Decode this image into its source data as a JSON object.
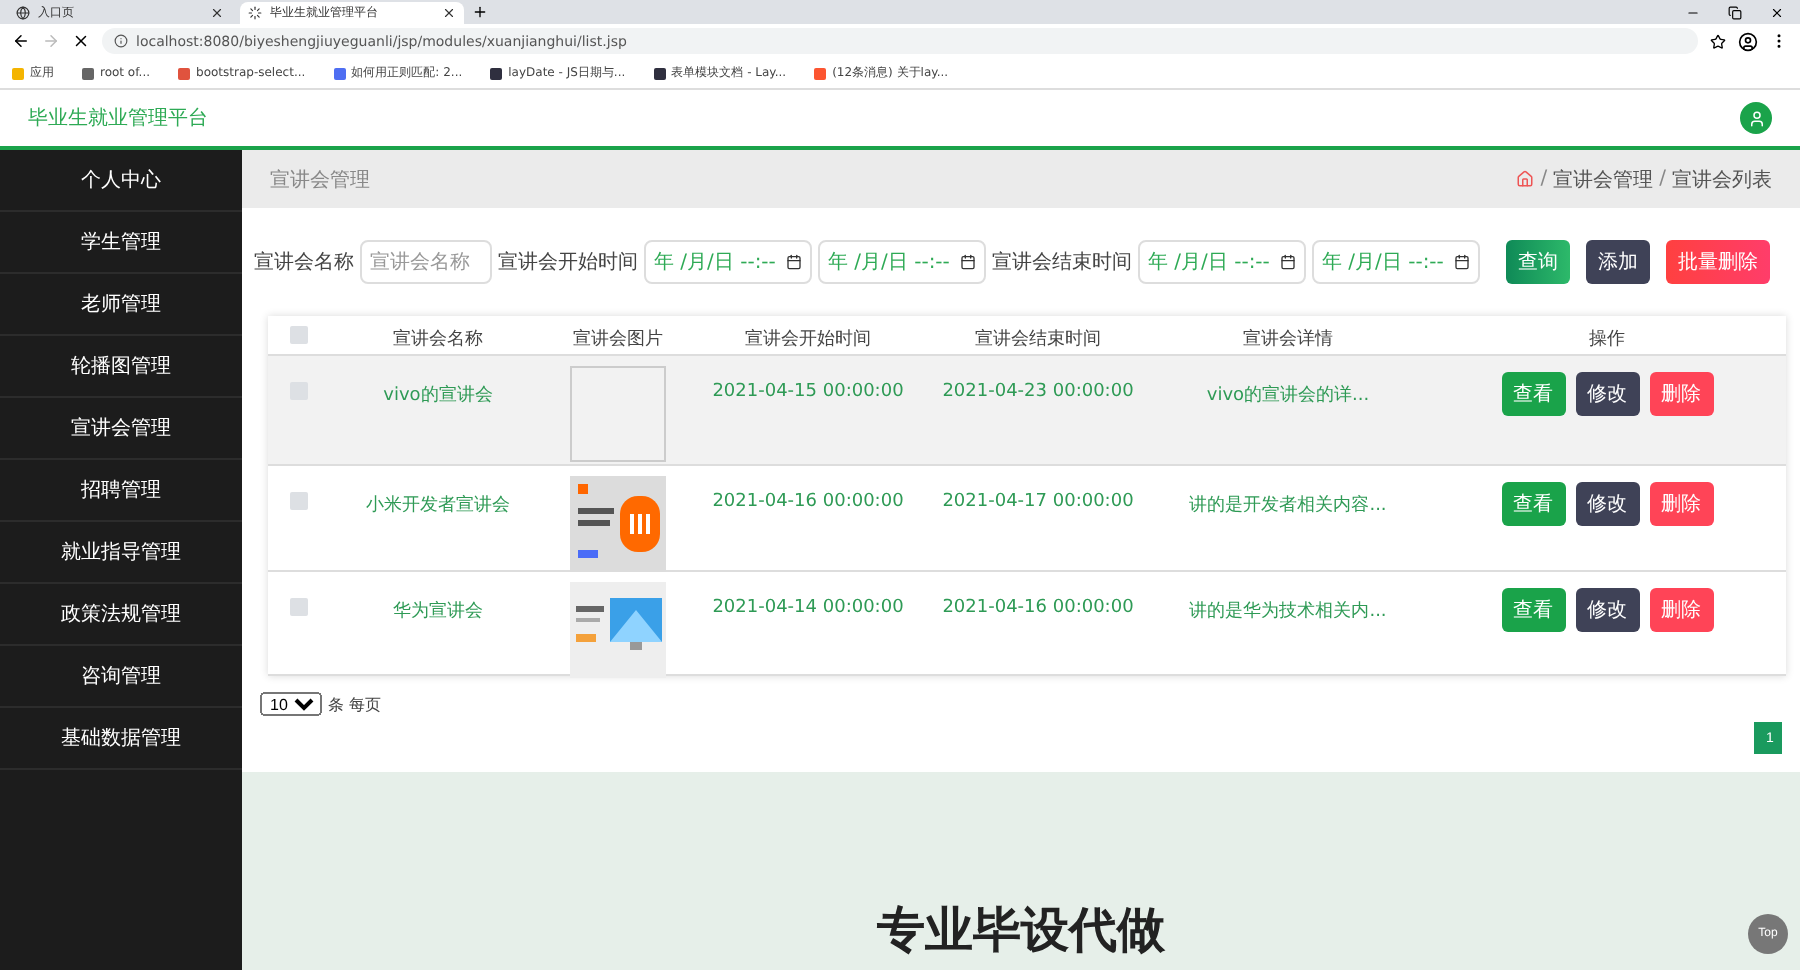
{
  "browser": {
    "tabs": [
      {
        "label": "入口页",
        "selected": false
      },
      {
        "label": "毕业生就业管理平台",
        "selected": true
      }
    ],
    "url": "localhost:8080/biyeshengjiuyeguanli/jsp/modules/xuanjianghui/list.jsp",
    "bookmarks": [
      {
        "label": "应用",
        "color": "#f4b400"
      },
      {
        "label": "root of...",
        "color": "#666666"
      },
      {
        "label": "bootstrap-select...",
        "color": "#e0533e"
      },
      {
        "label": "如何用正则匹配: 2...",
        "color": "#4e6ef2"
      },
      {
        "label": "layDate - JS日期与...",
        "color": "#2f2f3f"
      },
      {
        "label": "表单模块文档 - Lay...",
        "color": "#2f2f3f"
      },
      {
        "label": "(12条消息) 关于lay...",
        "color": "#fc5531"
      }
    ]
  },
  "header": {
    "title": "毕业生就业管理平台"
  },
  "sidebar": {
    "items": [
      {
        "label": "个人中心",
        "selected": false
      },
      {
        "label": "学生管理",
        "selected": false
      },
      {
        "label": "老师管理",
        "selected": false
      },
      {
        "label": "轮播图管理",
        "selected": false
      },
      {
        "label": "宣讲会管理",
        "selected": false
      },
      {
        "label": "招聘管理",
        "selected": false
      },
      {
        "label": "就业指导管理",
        "selected": false
      },
      {
        "label": "政策法规管理",
        "selected": false
      },
      {
        "label": "咨询管理",
        "selected": false
      },
      {
        "label": "基础数据管理",
        "selected": false
      }
    ]
  },
  "page_title": "宣讲会管理",
  "breadcrumb": [
    {
      "separator": "/",
      "label": "宣讲会管理"
    },
    {
      "separator": "/",
      "label": "宣讲会列表"
    }
  ],
  "search": {
    "name_label": "宣讲会名称",
    "name_placeholder": "宣讲会名称",
    "start_label": "宣讲会开始时间",
    "end_label": "宣讲会结束时间",
    "start_dates": [
      "年 /月/日 --:--",
      "年 /月/日 --:--"
    ],
    "end_dates": [
      "年 /月/日 --:--",
      "年 /月/日 --:--"
    ],
    "buttons": [
      {
        "label": "查询",
        "kind": "search"
      },
      {
        "label": "添加",
        "kind": "add"
      },
      {
        "label": "批量删除",
        "kind": "delete"
      }
    ]
  },
  "table": {
    "header_checked": false,
    "columns": [
      "宣讲会名称",
      "宣讲会图片",
      "宣讲会开始时间",
      "宣讲会结束时间",
      "宣讲会详情",
      "操作"
    ],
    "rows": [
      {
        "checked": false,
        "highlighted": true,
        "name": "vivo的宣讲会",
        "image": {
          "kind": "broken"
        },
        "start": "2021-04-15 00:00:00",
        "end": "2021-04-23 00:00:00",
        "detail": "vivo的宣讲会的详...",
        "actions": [
          "查看",
          "修改",
          "删除"
        ]
      },
      {
        "checked": false,
        "highlighted": false,
        "name": "小米开发者宣讲会",
        "start": "2021-04-16 00:00:00",
        "end": "2021-04-17 00:00:00",
        "detail": "讲的是开发者相关内容...",
        "actions": [
          "查看",
          "修改",
          "删除"
        ]
      },
      {
        "checked": false,
        "highlighted": false,
        "name": "华为宣讲会",
        "start": "2021-04-14 00:00:00",
        "end": "2021-04-16 00:00:00",
        "detail": "讲的是华为技术相关内...",
        "actions": [
          "查看",
          "修改",
          "删除"
        ]
      }
    ]
  },
  "pagination": {
    "page_size": "10",
    "page_size_label": "条 每页",
    "pages": [
      {
        "label": "1",
        "selected": true
      }
    ]
  },
  "promo": "专业毕设代做",
  "top_button": "Top"
}
